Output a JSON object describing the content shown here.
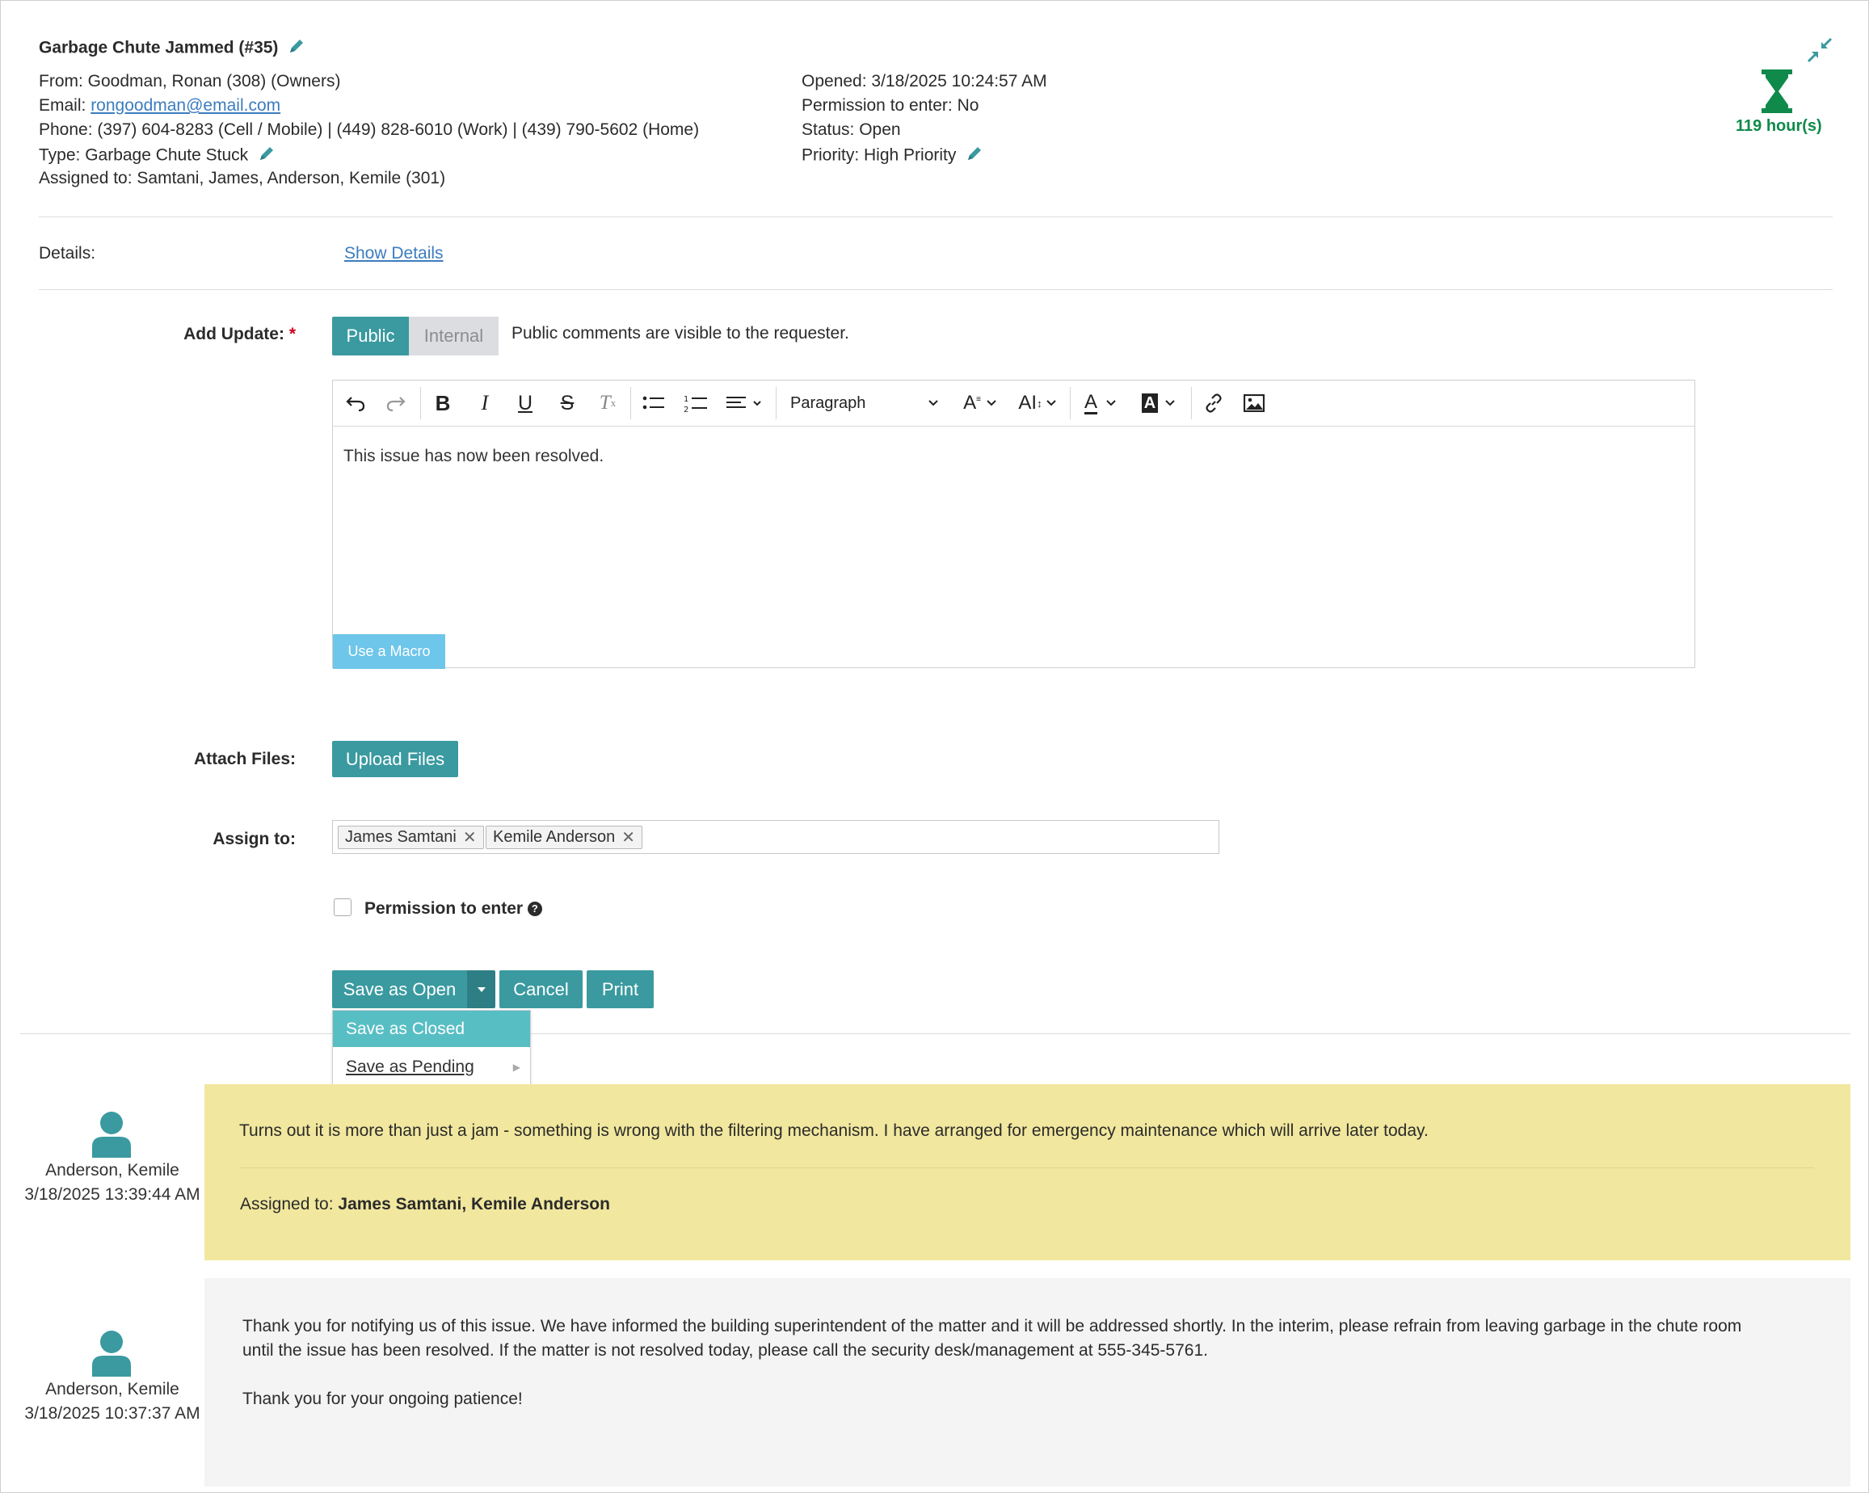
{
  "ticket": {
    "title": "Garbage Chute Jammed (#35)",
    "from": "From: Goodman, Ronan (308) (Owners)",
    "email_label": "Email: ",
    "email": "rongoodman@email.com",
    "phone": "Phone: (397) 604-8283 (Cell / Mobile) | (449) 828-6010 (Work) | (439) 790-5602 (Home)",
    "type": "Type: Garbage Chute Stuck",
    "assigned": "Assigned to: Samtani, James, Anderson, Kemile (301)",
    "opened": "Opened: 3/18/2025 10:24:57 AM",
    "permission": "Permission to enter: No",
    "status": "Status: Open",
    "priority": "Priority: High Priority",
    "timer": "119 hour(s)"
  },
  "details": {
    "label": "Details:",
    "link": "Show Details"
  },
  "update": {
    "label": "Add Update:",
    "required_mark": "*",
    "public_label": "Public",
    "internal_label": "Internal",
    "visibility_note": "Public comments are visible to the requester.",
    "editor_text": "This issue has now been resolved.",
    "block_format": "Paragraph",
    "macro_label": "Use a Macro"
  },
  "attach": {
    "label": "Attach Files:",
    "button": "Upload Files"
  },
  "assign": {
    "label": "Assign to:",
    "tags": [
      "James Samtani",
      "Kemile Anderson"
    ]
  },
  "permission": {
    "label": "Permission to enter",
    "checked": false
  },
  "actions": {
    "save_open": "Save as Open",
    "cancel": "Cancel",
    "print": "Print",
    "menu": [
      "Save as Closed",
      "Save as Pending"
    ]
  },
  "comments": [
    {
      "author": "Anderson, Kemile",
      "timestamp": "3/18/2025 13:39:44 AM",
      "text": "Turns out it is more than just a jam - something is wrong with the filtering mechanism. I have arranged for emergency maintenance which will arrive later today.",
      "assigned_label": "Assigned to: ",
      "assigned_names": "James Samtani, Kemile Anderson",
      "bg": "#f1e79e"
    },
    {
      "author": "Anderson, Kemile",
      "timestamp": "3/18/2025 10:37:37 AM",
      "text_line1": "Thank you for notifying us of this issue. We have informed the building superintendent of the matter and it will be addressed shortly. In the interim, please refrain from leaving garbage in the chute room",
      "text_line2": "until the issue has been resolved. If the matter is not resolved today, please call the security desk/management at 555-345-5761.",
      "text_line3": "Thank you for your ongoing patience!",
      "bg": "#f4f4f4"
    }
  ],
  "colors": {
    "accent": "#3a9aa0",
    "timer": "#0f8a4a",
    "link": "#3b7dbf",
    "required": "#d0021b"
  }
}
